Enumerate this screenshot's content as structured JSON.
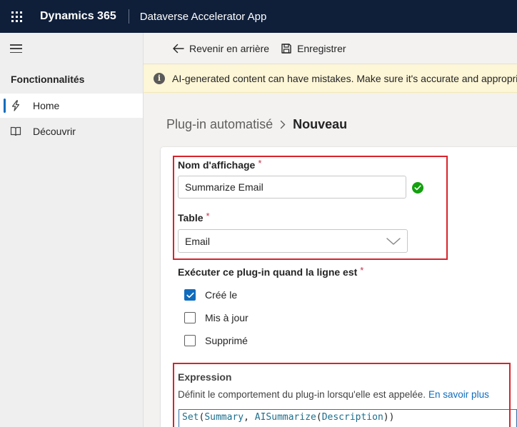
{
  "app": {
    "brand": "Dynamics 365",
    "name": "Dataverse Accelerator App"
  },
  "sidebar": {
    "title": "Fonctionnalités",
    "items": [
      {
        "label": "Home",
        "icon": "lightning-icon",
        "active": true
      },
      {
        "label": "Découvrir",
        "icon": "book-icon",
        "active": false
      }
    ]
  },
  "commandbar": {
    "back_label": "Revenir en arrière",
    "save_label": "Enregistrer"
  },
  "banner": {
    "text": "AI-generated content can have mistakes. Make sure it's accurate and appropriate before using it."
  },
  "breadcrumb": {
    "parent": "Plug-in automatisé",
    "current": "Nouveau"
  },
  "form": {
    "display_name": {
      "label": "Nom d'affichage",
      "required_mark": "*",
      "value": "Summarize Email"
    },
    "table": {
      "label": "Table",
      "required_mark": "*",
      "value": "Email"
    },
    "run_when": {
      "label": "Exécuter ce plug-in quand la ligne est",
      "required_mark": "*",
      "options": [
        {
          "label": "Créé le",
          "checked": true
        },
        {
          "label": "Mis à jour",
          "checked": false
        },
        {
          "label": "Supprimé",
          "checked": false
        }
      ]
    },
    "expression": {
      "label": "Expression",
      "description": "Définit le comportement du plug-in lorsqu'elle est appelée.",
      "link": "En savoir plus",
      "code": {
        "fn1": "Set",
        "open1": "(",
        "arg1": "Summary",
        "comma": ", ",
        "fn2": "AISummarize",
        "open2": "(",
        "arg2": "Description",
        "close": "))"
      }
    }
  },
  "colors": {
    "topbar": "#0f1f3a",
    "accent": "#0f6cbd",
    "highlight": "#d9232a",
    "success": "#13a10e",
    "banner": "#fdf6d7"
  }
}
